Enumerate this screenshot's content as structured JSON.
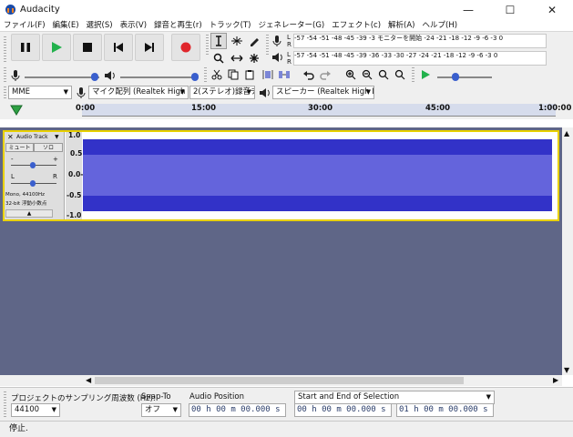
{
  "window": {
    "title": "Audacity",
    "minimize": "—",
    "maximize": "☐",
    "close": "✕"
  },
  "menu": [
    "ファイル(F)",
    "編集(E)",
    "選択(S)",
    "表示(V)",
    "録音と再生(r)",
    "トラック(T)",
    "ジェネレーター(G)",
    "エフェクト(c)",
    "解析(A)",
    "ヘルプ(H)"
  ],
  "meters": {
    "record_scale": "-57 -54 -51 -48 -45  -39 -3 モニターを開始 -24 -21 -18  -12 -9 -6 -3 0",
    "play_scale": "-57 -54 -51 -48 -45  -39 -36 -33 -30 -27 -24 -21 -18  -12 -9 -6 -3 0",
    "lr_l": "L",
    "lr_r": "R"
  },
  "devices": {
    "host": "MME",
    "mic": "マイク配列 (Realtek High De",
    "channels": "2(ステレオ)録音チ",
    "speaker": "スピーカー (Realtek High Defi"
  },
  "ruler": {
    "ticks": [
      "0:00",
      "15:00",
      "30:00",
      "45:00",
      "1:00:00"
    ]
  },
  "track": {
    "name": "Audio Track",
    "close": "✕",
    "menu_arrow": "▼",
    "mute": "ミュート",
    "solo": "ソロ",
    "gain_minus": "-",
    "gain_plus": "+",
    "pan_l": "L",
    "pan_r": "R",
    "info1": "Mono, 44100Hz",
    "info2": "32-bit 浮動小数点",
    "collapse": "▲",
    "scale": [
      "1.0",
      "0.5",
      "0.0-",
      "-0.5",
      "-1.0"
    ]
  },
  "colors": {
    "wave": "#3232c8",
    "wave_rms": "#6464dc",
    "track_bg": "#5f6687",
    "selected_border": "#e8d000"
  },
  "selbar": {
    "rate_label": "プロジェクトのサンプリング周波数 (Hz):",
    "rate_value": "44100",
    "snap_label": "Snap-To",
    "snap_value": "オフ",
    "audio_pos_label": "Audio Position",
    "audio_pos_value": "00 h 00 m 00.000 s",
    "selection_label": "Start and End of Selection",
    "sel_start": "00 h 00 m 00.000 s",
    "sel_end": "01 h 00 m 00.000 s"
  },
  "status": "停止."
}
